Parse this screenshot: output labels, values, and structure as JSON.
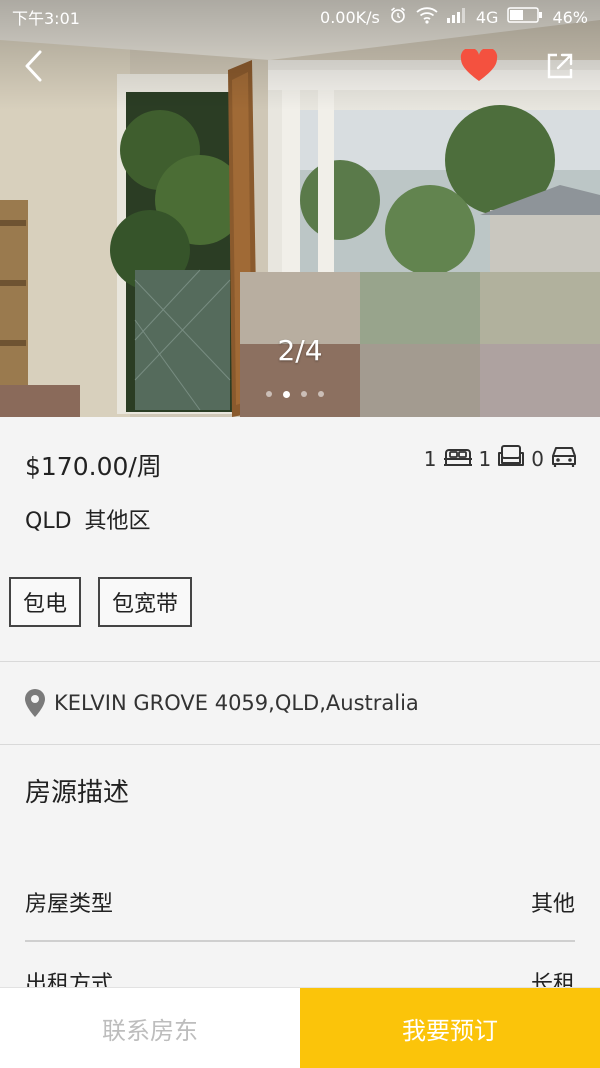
{
  "status_bar": {
    "time": "下午3:01",
    "network_speed": "0.00K/s",
    "network_type": "4G",
    "battery": "46%"
  },
  "gallery": {
    "counter": "2/4",
    "current": 2,
    "total": 4
  },
  "listing": {
    "price": "$170.00/周",
    "location": "QLD 其他区",
    "features": {
      "bedrooms": "1",
      "bathrooms": "1",
      "parking": "0"
    },
    "tags": [
      "包电",
      "包宽带"
    ],
    "address": "KELVIN GROVE 4059,QLD,Australia"
  },
  "description": {
    "title": "房源描述",
    "rows": [
      {
        "label": "房屋类型",
        "value": "其他"
      },
      {
        "label": "出租方式",
        "value": "长租"
      }
    ]
  },
  "actions": {
    "contact_label": "联系房东",
    "book_label": "我要预订"
  },
  "colors": {
    "accent": "#fbc40a",
    "favorite": "#f4513f"
  },
  "icons": {
    "back": "chevron-left-icon",
    "favorite": "heart-icon",
    "share": "share-icon",
    "location": "map-pin-icon",
    "bed": "bed-icon",
    "sofa": "sofa-icon",
    "car": "car-icon"
  }
}
